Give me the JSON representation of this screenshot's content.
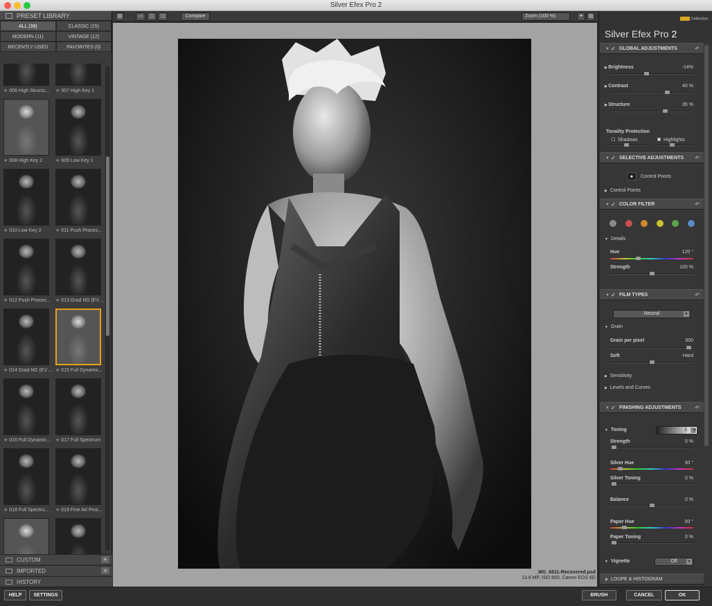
{
  "window": {
    "title": "Silver Efex Pro 2"
  },
  "library": {
    "header": "PRESET LIBRARY",
    "tabs": [
      "ALL (38)",
      "CLASSIC (15)",
      "MODERN (11)",
      "VINTAGE (12)",
      "RECENTLY USED",
      "FAVORITES (0)"
    ],
    "presets": [
      {
        "label": "006 High Structu...",
        "tone": "dark"
      },
      {
        "label": "007 High Key 1",
        "tone": "dark"
      },
      {
        "label": "008 High Key 2",
        "tone": "light"
      },
      {
        "label": "009 Low Key 1",
        "tone": "dark"
      },
      {
        "label": "010 Low Key 2",
        "tone": "dark"
      },
      {
        "label": "011 Push Proces...",
        "tone": "dark"
      },
      {
        "label": "012 Push Proces...",
        "tone": "dark"
      },
      {
        "label": "013 Grad ND (EV ...",
        "tone": "dark"
      },
      {
        "label": "014 Grad ND (EV ...",
        "tone": "dark"
      },
      {
        "label": "015 Full Dynamic...",
        "tone": "light",
        "selected": true
      },
      {
        "label": "016 Full Dynamic...",
        "tone": "dark"
      },
      {
        "label": "017 Full Spectrum",
        "tone": "dark"
      },
      {
        "label": "018 Full Spectru...",
        "tone": "dark"
      },
      {
        "label": "019 Fine Art Proc...",
        "tone": "dark"
      },
      {
        "label": "",
        "tone": "light"
      },
      {
        "label": "",
        "tone": "dark"
      }
    ],
    "sections": [
      "CUSTOM",
      "IMPORTED",
      "HISTORY"
    ]
  },
  "toolbar": {
    "compare": "Compare",
    "zoom": "Zoom (100 %)"
  },
  "image": {
    "filename": "_MG_6611-Recovered.psd",
    "info": "13.8 MP, ISO 800, Canon EOS 6D"
  },
  "panel": {
    "brand": "Silver Efex Pro",
    "brand_num": "2",
    "brand_logo": "Collection",
    "global": {
      "title": "GLOBAL ADJUSTMENTS",
      "sliders": [
        {
          "label": "Brightness",
          "value": "-14%",
          "pos": 0.43
        },
        {
          "label": "Contrast",
          "value": "40 %",
          "pos": 0.7
        },
        {
          "label": "Structure",
          "value": "35 %",
          "pos": 0.67
        }
      ],
      "tonality": "Tonality Protection",
      "shadows": "Shadows",
      "highlights": "Highlights"
    },
    "selective": {
      "title": "SELECTIVE ADJUSTMENTS",
      "cp_button": "Control Points",
      "cp_list": "Control Points"
    },
    "color": {
      "title": "COLOR FILTER",
      "dots": [
        "#8a8a8a",
        "#c94f4f",
        "#d08a2e",
        "#c8c22e",
        "#5aa44a",
        "#5a8ac9"
      ],
      "details": "Details",
      "hue_label": "Hue",
      "hue_value": "120 °",
      "hue_pos": 0.33,
      "strength_label": "Strength",
      "strength_value": "100 %",
      "strength_pos": 0.5
    },
    "film": {
      "title": "FILM TYPES",
      "select": "Neutral",
      "grain": "Grain",
      "gpp_label": "Grain per pixel",
      "gpp_value": "500",
      "gpp_pos": 0.97,
      "soft": "Soft",
      "hard": "Hard",
      "soft_pos": 0.5,
      "sensitivity": "Sensitivity",
      "levels": "Levels and Curves"
    },
    "finishing": {
      "title": "FINISHING ADJUSTMENTS",
      "toning": "Toning",
      "toning_num": "1",
      "sliders": [
        {
          "label": "Strength",
          "value": "0 %",
          "pos": 0.02,
          "rainbow": false
        },
        {
          "label": "Silver Hue",
          "value": "30 °",
          "pos": 0.1,
          "rainbow": true
        },
        {
          "label": "Silver Toning",
          "value": "0 %",
          "pos": 0.02,
          "rainbow": false
        },
        {
          "label": "Balance",
          "value": "0 %",
          "pos": 0.5,
          "rainbow": false
        },
        {
          "label": "Paper Hue",
          "value": "50 °",
          "pos": 0.15,
          "rainbow": true
        },
        {
          "label": "Paper Toning",
          "value": "0 %",
          "pos": 0.02,
          "rainbow": false
        }
      ],
      "vignette": "Vignette",
      "vignette_value": "Off"
    },
    "loupe": "LOUPE & HISTOGRAM"
  },
  "bottom": {
    "help": "HELP",
    "settings": "SETTINGS",
    "brush": "BRUSH",
    "cancel": "CANCEL",
    "ok": "OK"
  }
}
